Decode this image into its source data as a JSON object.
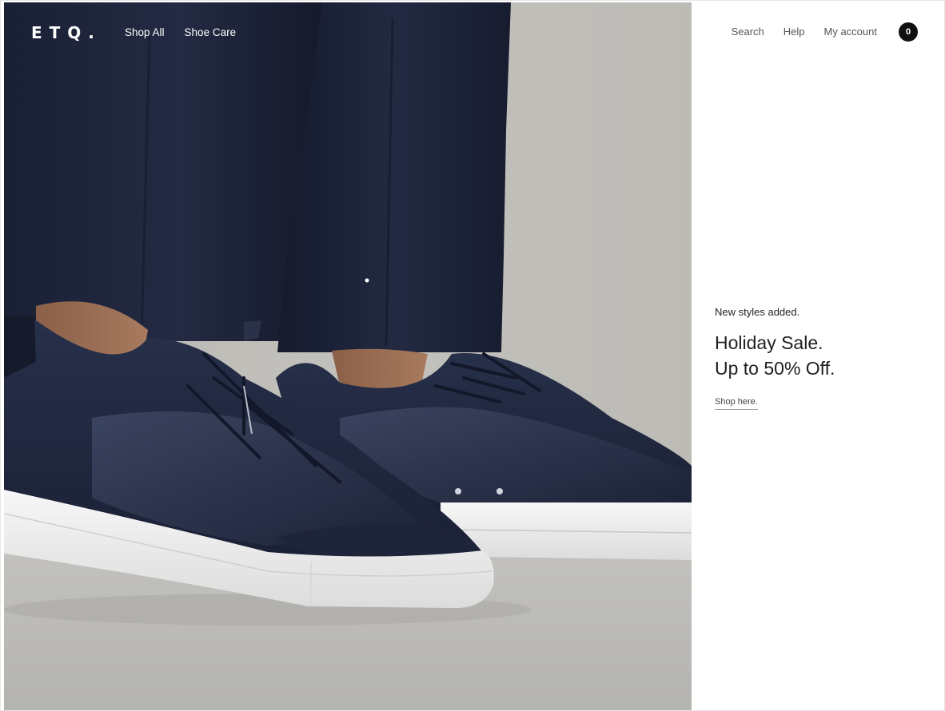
{
  "header": {
    "logo": "ETQ.",
    "nav_left": [
      "Shop All",
      "Shoe Care"
    ],
    "nav_right": [
      "Search",
      "Help",
      "My account"
    ],
    "cart_count": "0"
  },
  "hero": {
    "image": "navy leather and suede low-top sneakers with white soles worn with navy trousers"
  },
  "promo": {
    "eyebrow": "New styles added.",
    "headline_line1": "Holiday Sale.",
    "headline_line2": "Up to 50% Off.",
    "link": "Shop here."
  },
  "colors": {
    "accent": "#111111",
    "navy": "#1c2235",
    "wall": "#bdbcb7",
    "floor": "#b9b8b4"
  }
}
